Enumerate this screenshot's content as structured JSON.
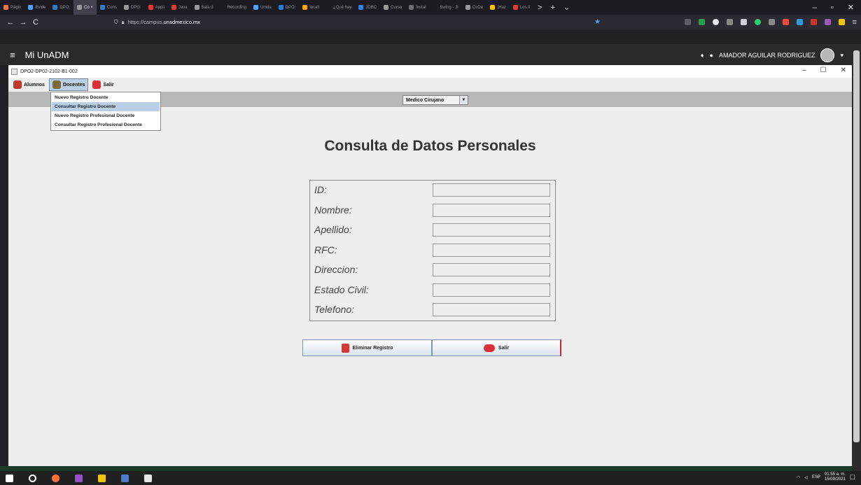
{
  "browser": {
    "tabs": [
      {
        "label": "Págin",
        "color": "#ff7139"
      },
      {
        "label": "Evide",
        "color": "#4fa3f7"
      },
      {
        "label": "DPO:",
        "color": "#2b7cd3"
      },
      {
        "label": "Co ×",
        "color": "#9a9a9a",
        "active": true
      },
      {
        "label": "Cons",
        "color": "#2b7cd3"
      },
      {
        "label": "DPO:",
        "color": "#9a9a9a"
      },
      {
        "label": "Appli",
        "color": "#e53935"
      },
      {
        "label": "Java",
        "color": "#e53935"
      },
      {
        "label": "Sala d",
        "color": "#9a9a9a"
      },
      {
        "label": "Recording",
        "color": "#1c1b22"
      },
      {
        "label": "Unida",
        "color": "#4fa3f7"
      },
      {
        "label": "DPO:",
        "color": "#2b7cd3"
      },
      {
        "label": "locali",
        "color": "#f7a600"
      },
      {
        "label": "¿Qué hay",
        "color": "#1c1b22"
      },
      {
        "label": "JDBC",
        "color": "#2e86de"
      },
      {
        "label": "Curso",
        "color": "#9a9a9a"
      },
      {
        "label": "Instal",
        "color": "#6d6d6d"
      },
      {
        "label": "Swing - JI",
        "color": "#1c1b22"
      },
      {
        "label": "CoDe",
        "color": "#9a9a9a"
      },
      {
        "label": "¡Haz",
        "color": "#f7c600"
      },
      {
        "label": "Los Il",
        "color": "#e53935"
      }
    ],
    "tab_controls": {
      "scroll_right": ">",
      "new_tab": "+",
      "list": "⌄",
      "minimize": "–",
      "restore": "▫",
      "close": "✕"
    },
    "nav": {
      "back": "←",
      "forward": "→",
      "reload": "C"
    },
    "url": {
      "prefix": "https://campus.",
      "host": "unadmexico.mx"
    },
    "bookmark_star": "★"
  },
  "site": {
    "menu_icon": "≡",
    "brand": "Mi UnADM",
    "bell_icon": "🔔",
    "chat_icon": "💬",
    "user_name": "AMADOR AGUILAR RODRIGUEZ",
    "user_menu": "▾"
  },
  "window": {
    "title": "DPO2-DP02-2102-B1-002",
    "controls": {
      "minimize": "–",
      "maximize": "☐",
      "close": "✕"
    }
  },
  "menubar": {
    "items": [
      {
        "label": "Alumnos",
        "icon_color": "#c0392b"
      },
      {
        "label": "Docentes",
        "icon_color": "#7d6a3a",
        "selected": true
      },
      {
        "label": "Salir",
        "icon_color": "#d9303a"
      }
    ]
  },
  "combo": {
    "value": "Medico Cirujano",
    "arrow": "▼"
  },
  "dropdown": {
    "items": [
      {
        "label": "Nuevo Registro Docente"
      },
      {
        "label": "Consultar Registro Docente",
        "highlighted": true
      },
      {
        "label": "Nuevo Registro Profesional Docente"
      },
      {
        "label": "Consultar Registro Profesional Docente"
      }
    ]
  },
  "form": {
    "title": "Consulta de Datos Personales",
    "fields": [
      {
        "label": "ID:",
        "value": ""
      },
      {
        "label": "Nombre:",
        "value": ""
      },
      {
        "label": "Apellido:",
        "value": ""
      },
      {
        "label": "RFC:",
        "value": ""
      },
      {
        "label": "Direccion:",
        "value": ""
      },
      {
        "label": "Estado Civil:",
        "value": ""
      },
      {
        "label": "Telefono:",
        "value": ""
      }
    ],
    "buttons": {
      "delete": "Eliminar Registro",
      "exit": "Salir"
    }
  },
  "taskbar": {
    "tray": {
      "lang": "ESP",
      "time": "01:55 a. m.",
      "date": "15/09/2021"
    }
  }
}
